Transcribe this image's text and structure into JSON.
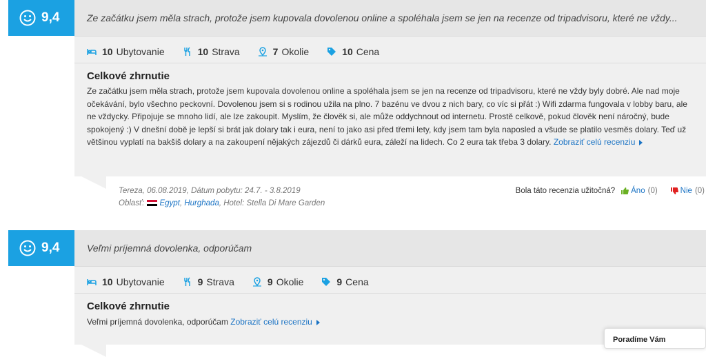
{
  "reviews": [
    {
      "score": "9,4",
      "headline": "Ze začátku jsem měla strach, protože jsem kupovala dovolenou online a spoléhala jsem se jen na recenze od tripadvisoru, které ne vždy...",
      "ratings": [
        {
          "value": "10",
          "label": "Ubytovanie",
          "icon": "bed-icon"
        },
        {
          "value": "10",
          "label": "Strava",
          "icon": "fork-knife-icon"
        },
        {
          "value": "7",
          "label": "Okolie",
          "icon": "map-pin-icon"
        },
        {
          "value": "10",
          "label": "Cena",
          "icon": "price-tag-icon"
        }
      ],
      "summary_title": "Celkové zhrnutie",
      "text": "Ze začátku jsem měla strach, protože jsem kupovala dovolenou online a spoléhala jsem se jen na recenze od tripadvisoru, které ne vždy byly dobré. Ale nad moje očekávání, bylo všechno peckovní. Dovolenou jsem si s rodinou užila na plno. 7 bazénu ve dvou z nich bary, co víc si přát :) Wifi zdarma fungovala v lobby baru, ale ne vždycky. Připojuje se mnoho lidí, ale lze zakoupit. Myslím, že člověk si, ale může oddychnout od internetu. Prostě celkově, pokud člověk není náročný, bude spokojený :) V dnešní době je lepší si brát jak dolary tak i eura, není to jako asi před třemi lety, kdy jsem tam byla naposled a všude se platilo vesměs dolary. Teď už většinou vyplatí na bakšiš dolary a na zakoupení nějakých zájezdů či dárků eura, záleží na lidech. Co 2 eura tak třeba 3 dolary.",
      "more_link": "Zobraziť celú recenziu",
      "author_line": "Tereza, 06.08.2019, Dátum pobytu: 24.7. - 3.8.2019",
      "area_label": "Oblasť:",
      "country": "Egypt",
      "city": "Hurghada",
      "hotel": "Hotel: Stella Di Mare Garden",
      "helpful_question": "Bola táto recenzia užitočná?",
      "yes_label": "Áno",
      "yes_count": "(0)",
      "no_label": "Nie",
      "no_count": "(0)"
    },
    {
      "score": "9,4",
      "headline": "Veľmi príjemná dovolenka, odporúčam",
      "ratings": [
        {
          "value": "10",
          "label": "Ubytovanie",
          "icon": "bed-icon"
        },
        {
          "value": "9",
          "label": "Strava",
          "icon": "fork-knife-icon"
        },
        {
          "value": "9",
          "label": "Okolie",
          "icon": "map-pin-icon"
        },
        {
          "value": "9",
          "label": "Cena",
          "icon": "price-tag-icon"
        }
      ],
      "summary_title": "Celkové zhrnutie",
      "text": "Veľmi príjemná dovolenka, odporúčam",
      "more_link": "Zobraziť celú recenziu"
    }
  ],
  "popup": {
    "title": "Poradíme Vám"
  },
  "colors": {
    "accent": "#1ba1e2",
    "link": "#1a73c4"
  }
}
